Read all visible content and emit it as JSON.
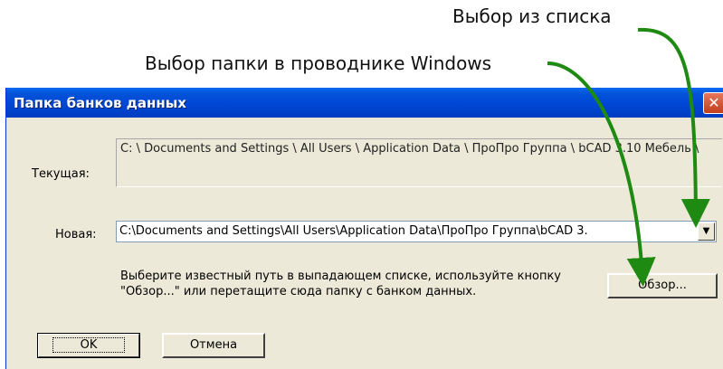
{
  "annotations": {
    "list_select": "Выбор из списка",
    "browse_select": "Выбор папки в проводнике Windows"
  },
  "dialog": {
    "title": "Папка банков данных",
    "close_glyph": "✕",
    "current_label": "Текущая:",
    "current_path": "C: \\ Documents and Settings \\ All Users \\ Application Data \\ ПроПро Группа \\ bCAD 3.10 Мебель \\",
    "new_label": "Новая:",
    "new_path": "C:\\Documents and Settings\\All Users\\Application Data\\ПроПро Группа\\bCAD 3.",
    "dropdown_glyph": "▼",
    "hint": "Выберите известный путь в выпадающем списке, используйте кнопку \"Обзор...\" или перетащите сюда папку с банком данных.",
    "browse_label": "Обзор...",
    "ok_label": "OK",
    "cancel_label": "Отмена"
  },
  "colors": {
    "arrow": "#1f8a12",
    "titlebar": "#0046d5",
    "dialog_bg": "#ece9d8"
  }
}
